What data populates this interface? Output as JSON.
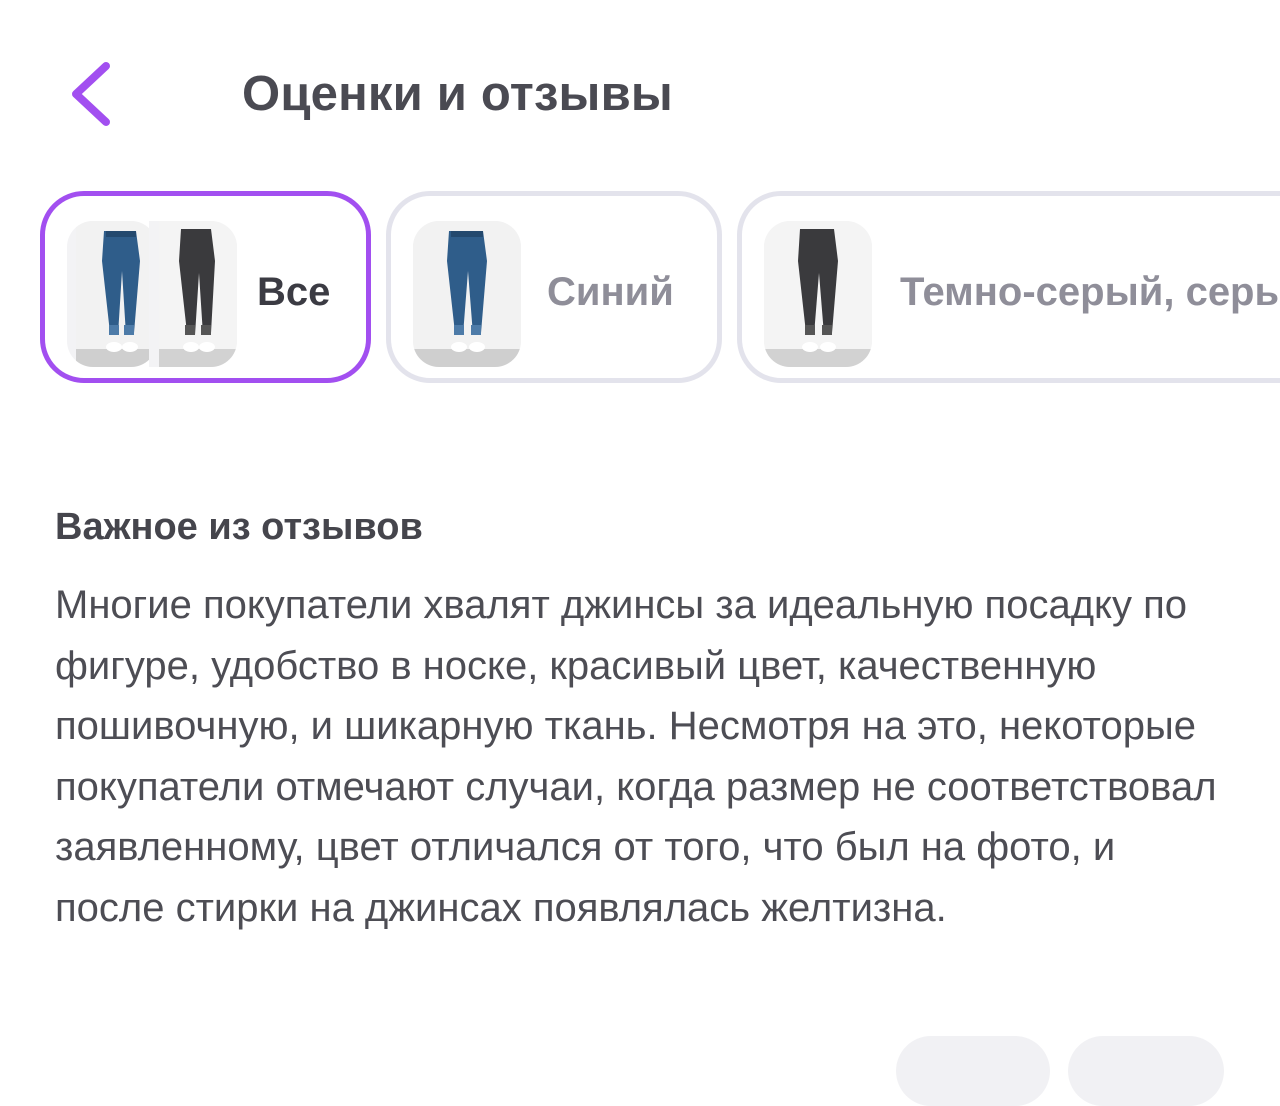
{
  "header": {
    "title": "Оценки и отзывы",
    "back_icon": "chevron-left-icon",
    "accent_color": "#a24ff0"
  },
  "chips": [
    {
      "label": "Все",
      "selected": true
    },
    {
      "label": "Синий",
      "selected": false
    },
    {
      "label": "Темно-серый, серый",
      "selected": false
    }
  ],
  "summary": {
    "title": "Важное из отзывов",
    "text": "Многие покупатели хвалят джинсы за идеальную посадку по фигуре, удобство в носке, красивый цвет, качественную пошивочную, и шикарную ткань. Несмотря на это, некоторые покупатели отмечают случаи, когда размер не соответствовал заявленному, цвет отличался от того, что был на фото, и после стирки на джинсах появлялась желтизна."
  }
}
